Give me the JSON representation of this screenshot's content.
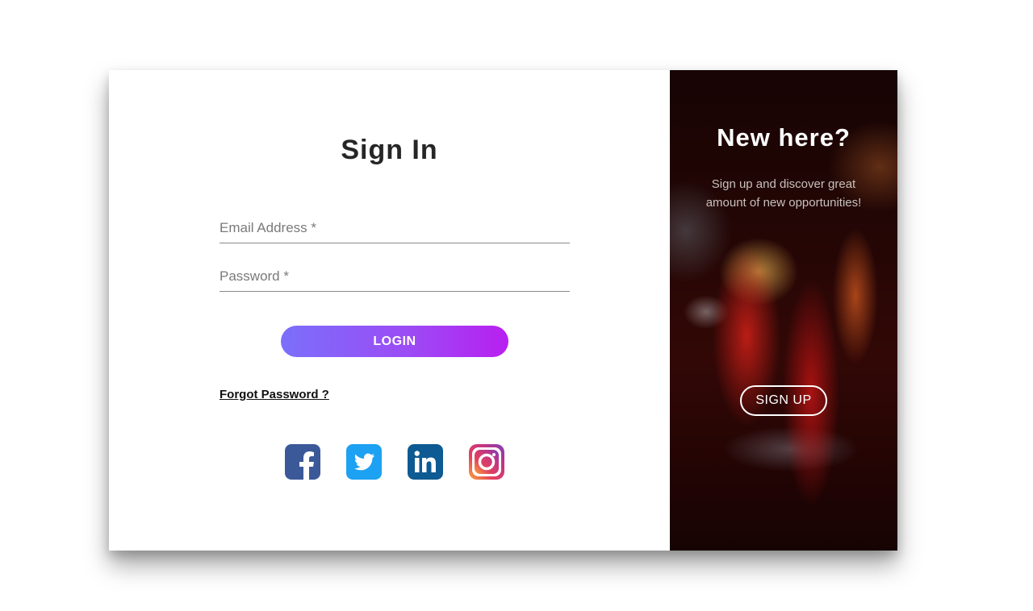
{
  "signin": {
    "title": "Sign In",
    "email_placeholder": "Email Address *",
    "password_placeholder": "Password *",
    "login_label": "LOGIN",
    "forgot_label": "Forgot Password ?"
  },
  "socials": [
    {
      "name": "facebook",
      "color": "#3b5998"
    },
    {
      "name": "twitter",
      "color": "#1da1f2"
    },
    {
      "name": "linkedin",
      "color": "#0e5a92"
    },
    {
      "name": "instagram",
      "color": "#c13584"
    }
  ],
  "signup": {
    "title": "New here?",
    "subtitle": "Sign up and discover great amount of new opportunities!",
    "button_label": "SIGN UP"
  },
  "colors": {
    "login_gradient_start": "#7b6ffb",
    "login_gradient_end": "#b81ff0"
  }
}
